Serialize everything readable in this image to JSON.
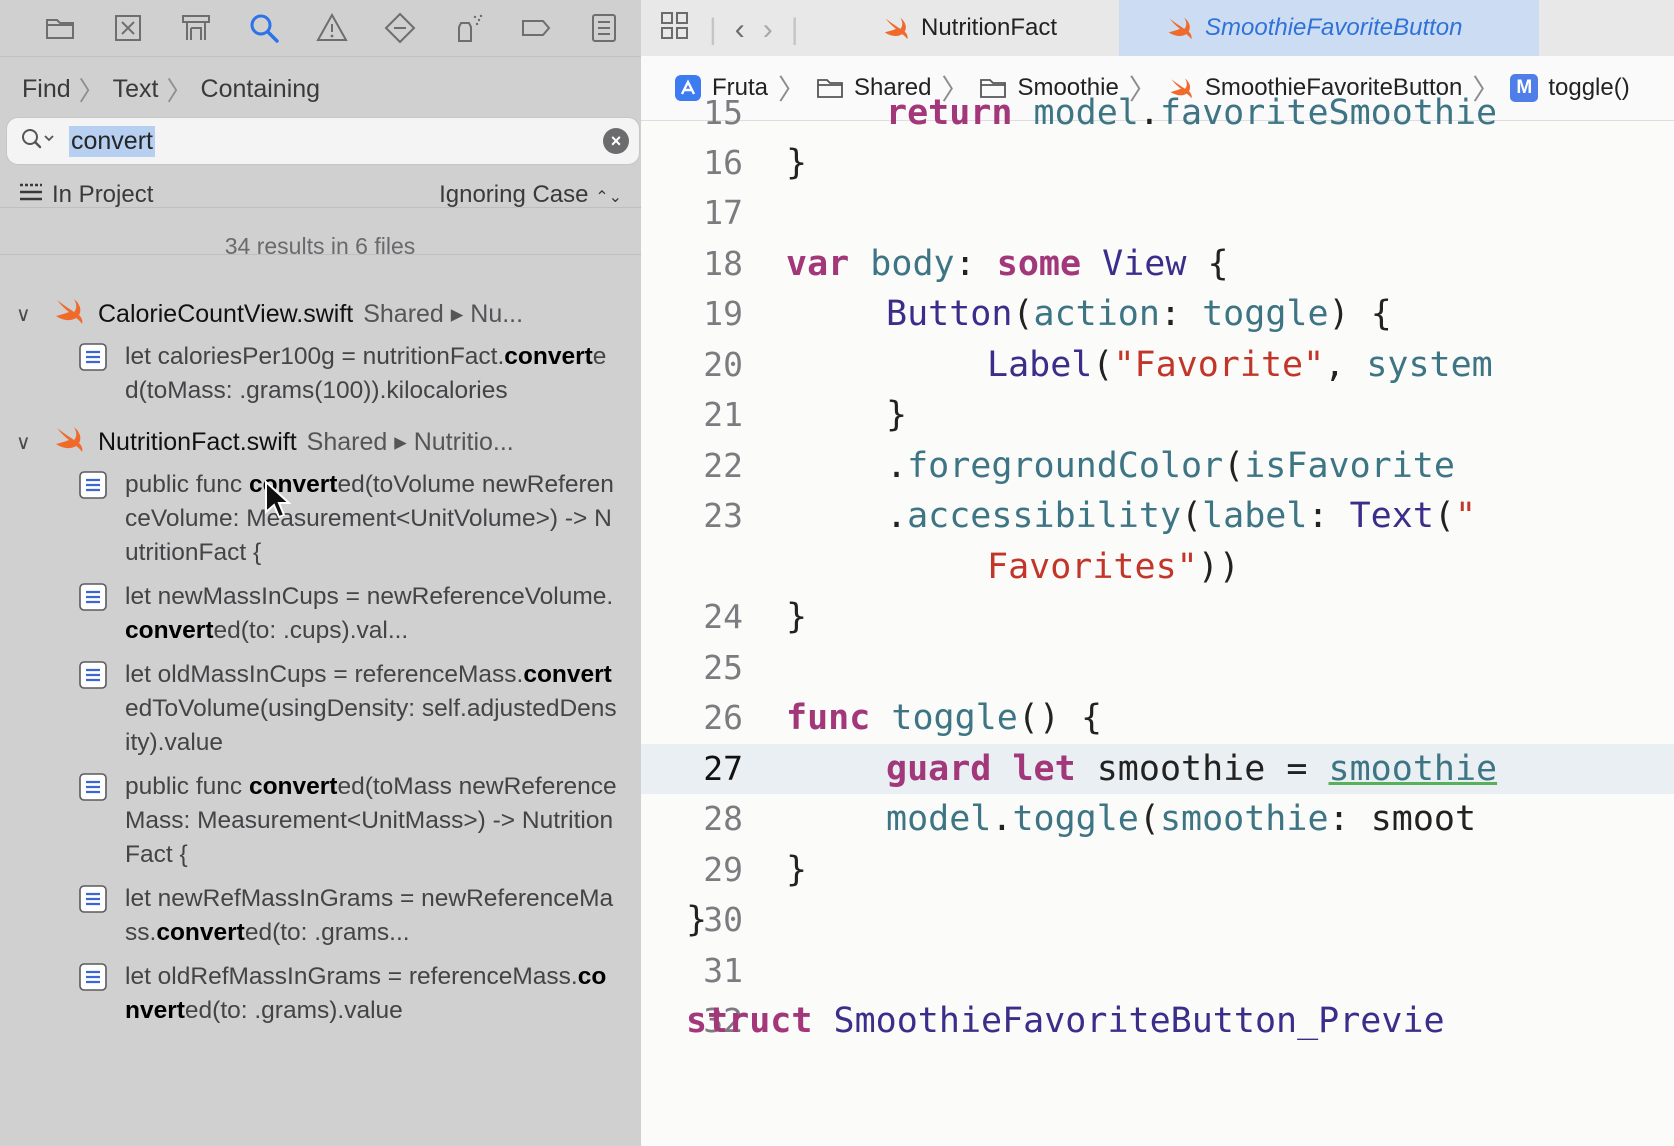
{
  "find": {
    "path": [
      "Find",
      "Text",
      "Containing"
    ],
    "search_value": "convert",
    "scope": "In Project",
    "case_mode": "Ignoring Case",
    "results_summary": "34 results in 6 files"
  },
  "results": {
    "files": [
      {
        "name": "CalorieCountView.swift",
        "path": "Shared ▸ Nu...",
        "matches": [
          {
            "pre": "let caloriesPer100g = nutritionFact.",
            "hit": "convert",
            "post": "ed(toMass: .grams(100)).kilocalories"
          }
        ]
      },
      {
        "name": "NutritionFact.swift",
        "path": "Shared ▸ Nutritio...",
        "matches": [
          {
            "pre": "public func ",
            "hit": "convert",
            "post": "ed(toVolume newReferenceVolume: Measurement<UnitVolume>) -> NutritionFact {"
          },
          {
            "pre": "let newMassInCups = newReferenceVolume.",
            "hit": "convert",
            "post": "ed(to: .cups).val..."
          },
          {
            "pre": "let oldMassInCups = referenceMass.",
            "hit": "convert",
            "post": "edToVolume(usingDensity: self.adjustedDensity).value"
          },
          {
            "pre": "public func ",
            "hit": "convert",
            "post": "ed(toMass newReferenceMass: Measurement<UnitMass>) -> NutritionFact {"
          },
          {
            "pre": "let newRefMassInGrams = newReferenceMass.",
            "hit": "convert",
            "post": "ed(to: .grams..."
          },
          {
            "pre": "let oldRefMassInGrams = referenceMass.",
            "hit": "convert",
            "post": "ed(to: .grams).value"
          }
        ]
      }
    ]
  },
  "tabs": {
    "tab1": "NutritionFact",
    "tab2": "SmoothieFavoriteButton"
  },
  "jumpbar": {
    "project": "Fruta",
    "folder1": "Shared",
    "folder2": "Smoothie",
    "file": "SmoothieFavoriteButton",
    "method_badge": "M",
    "method": "toggle()"
  },
  "code": {
    "lines": [
      {
        "n": "15",
        "t": "return model.favoriteSmoothie"
      },
      {
        "n": "16",
        "t": "}"
      },
      {
        "n": "17",
        "t": ""
      },
      {
        "n": "18",
        "t": "var body: some View {"
      },
      {
        "n": "19",
        "t": "Button(action: toggle) {"
      },
      {
        "n": "20",
        "t": "Label(\"Favorite\", system"
      },
      {
        "n": "21",
        "t": "}"
      },
      {
        "n": "22",
        "t": ".foregroundColor(isFavorite"
      },
      {
        "n": "23",
        "t": ".accessibility(label: Text(\""
      },
      {
        "n": "",
        "t": "Favorites\"))"
      },
      {
        "n": "24",
        "t": "}"
      },
      {
        "n": "25",
        "t": ""
      },
      {
        "n": "26",
        "t": "func toggle() {"
      },
      {
        "n": "27",
        "t": "guard let smoothie = smoothie"
      },
      {
        "n": "28",
        "t": "model.toggle(smoothie: smoot"
      },
      {
        "n": "29",
        "t": "}"
      },
      {
        "n": "30",
        "t": "}"
      },
      {
        "n": "31",
        "t": ""
      },
      {
        "n": "32",
        "t": "struct SmoothieFavoriteButton_Previe"
      }
    ]
  }
}
